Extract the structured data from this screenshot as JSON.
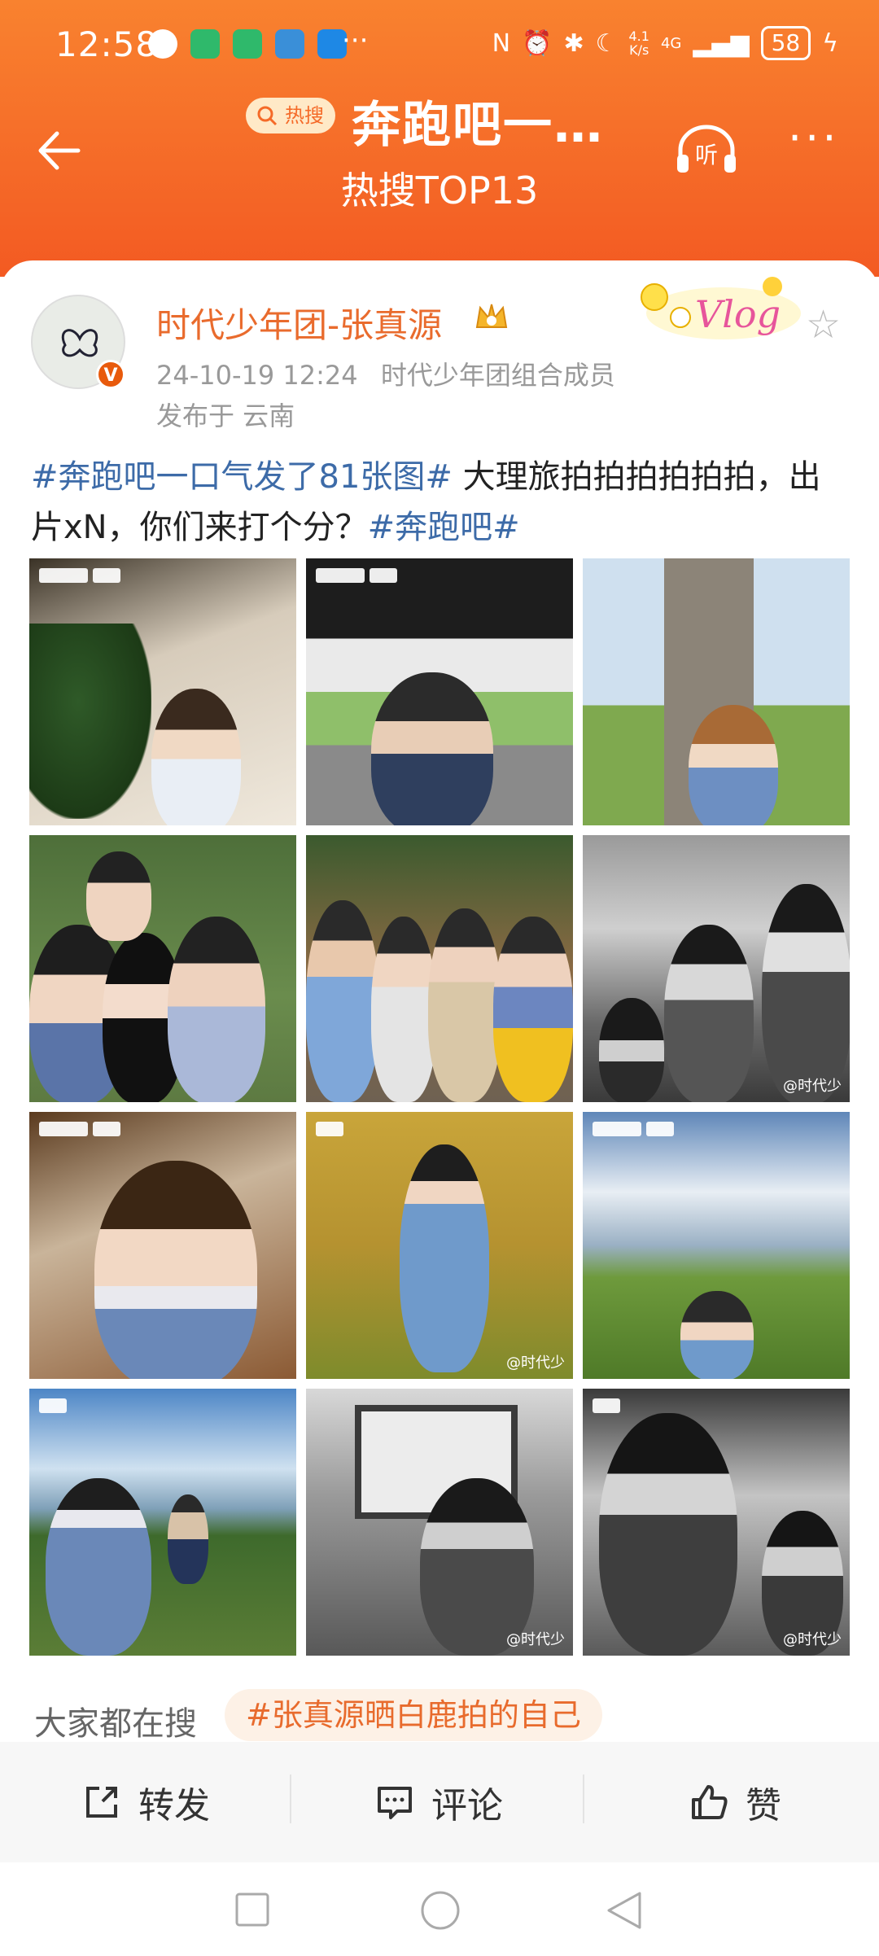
{
  "status_bar": {
    "time": "12:58",
    "speed": "4.1\nK/s",
    "network": "4G",
    "battery": "58",
    "more": "···"
  },
  "header": {
    "badge": "热搜",
    "title": "奔跑吧一…",
    "subtitle": "热搜TOP13",
    "listen_label": "听",
    "more": "···"
  },
  "post": {
    "username": "时代少年团-张真源",
    "datetime": "24-10-19 12:24",
    "source": "时代少年团组合成员",
    "location": "发布于 云南",
    "verified_mark": "V",
    "vlog_sticker": "Vlog",
    "topic1": "#奔跑吧一口气发了81张图#",
    "text1": " 大理旅拍拍拍拍拍拍，出片xN，你们来打个分？",
    "topic2": "#奔跑吧#",
    "watermark": "@时代少"
  },
  "photos": [
    {
      "id": "photo-1"
    },
    {
      "id": "photo-2"
    },
    {
      "id": "photo-3"
    },
    {
      "id": "photo-4"
    },
    {
      "id": "photo-5"
    },
    {
      "id": "photo-6"
    },
    {
      "id": "photo-7"
    },
    {
      "id": "photo-8"
    },
    {
      "id": "photo-9"
    },
    {
      "id": "photo-10"
    },
    {
      "id": "photo-11"
    },
    {
      "id": "photo-12"
    }
  ],
  "search": {
    "label": "大家都在搜",
    "chip": "#张真源晒白鹿拍的自己"
  },
  "actions": {
    "repost": "转发",
    "comment": "评论",
    "like": "赞"
  },
  "colors": {
    "header_orange": "#f56a28",
    "username_orange": "#e96b2d",
    "topic_blue": "#3d6ba8"
  }
}
